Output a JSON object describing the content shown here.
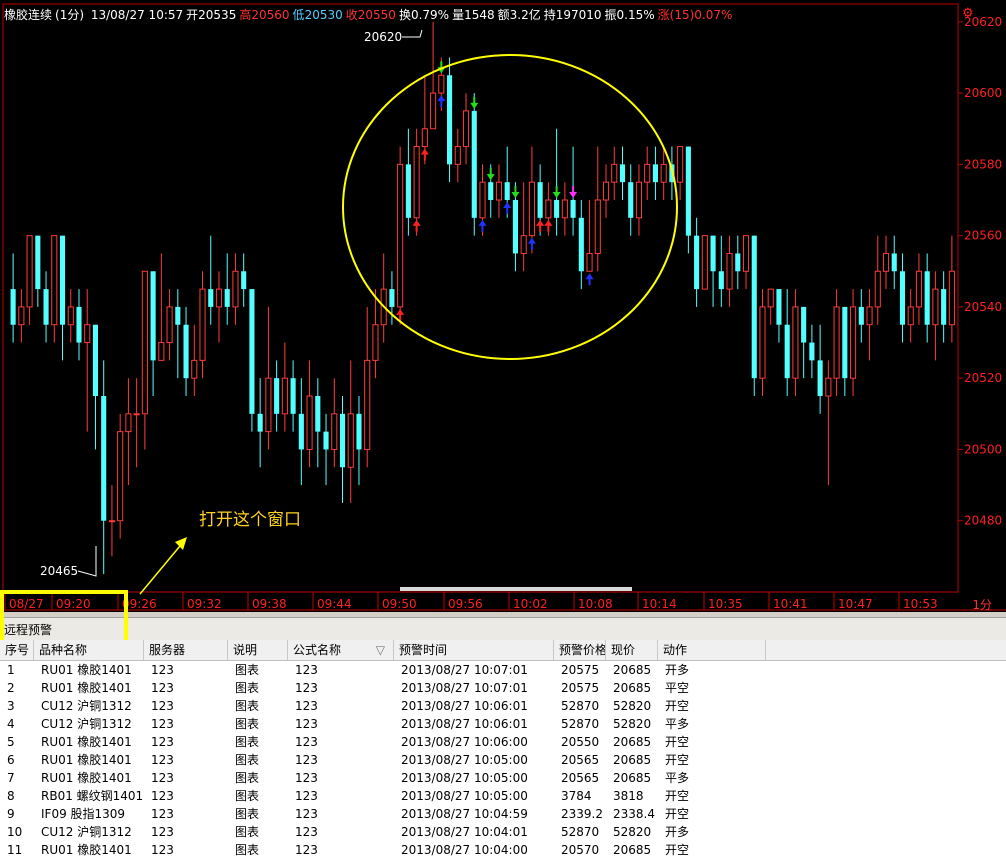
{
  "header": {
    "name": "橡胶连续",
    "period": "(1分)",
    "datetime": "13/08/27 10:57",
    "open_label": "开",
    "open_value": "20535",
    "high_label": "高",
    "high_value": "20560",
    "low_label": "低",
    "low_value": "20530",
    "close_label": "收",
    "close_value": "20550",
    "turnover": "换0.79%",
    "volume": "量1548",
    "amount": "额3.2亿",
    "position": "持197010",
    "amplitude": "振0.15%",
    "change": "涨(15)0.07%"
  },
  "colors": {
    "up": "#ff3b3b",
    "down": "#54ffff",
    "annotation": "#ffff00",
    "axis": "#c00000",
    "label": "#ff2020"
  },
  "chart_data": {
    "type": "candlestick",
    "y_ticks": [
      "20620",
      "20600",
      "20580",
      "20560",
      "20540",
      "20520",
      "20500",
      "20480"
    ],
    "x_ticks": [
      "08/27",
      "09:20",
      "09:26",
      "09:32",
      "09:38",
      "09:44",
      "09:50",
      "09:56",
      "10:02",
      "10:08",
      "10:14",
      "10:35",
      "10:41",
      "10:47",
      "10:53"
    ],
    "ylim": [
      20460,
      20625
    ],
    "high_marker": "20620",
    "low_marker": "20465",
    "unit": "1分",
    "candles": [
      [
        20545,
        20535,
        20555,
        20530
      ],
      [
        20535,
        20540,
        20545,
        20530
      ],
      [
        20540,
        20560,
        20560,
        20535
      ],
      [
        20560,
        20545,
        20560,
        20540
      ],
      [
        20545,
        20535,
        20550,
        20530
      ],
      [
        20535,
        20560,
        20560,
        20530
      ],
      [
        20560,
        20535,
        20560,
        20525
      ],
      [
        20535,
        20540,
        20545,
        20530
      ],
      [
        20540,
        20530,
        20545,
        20525
      ],
      [
        20530,
        20535,
        20545,
        20505
      ],
      [
        20535,
        20515,
        20535,
        20500
      ],
      [
        20515,
        20480,
        20525,
        20465
      ],
      [
        20480,
        20480,
        20490,
        20470
      ],
      [
        20480,
        20505,
        20510,
        20475
      ],
      [
        20505,
        20510,
        20520,
        20490
      ],
      [
        20510,
        20510,
        20520,
        20495
      ],
      [
        20510,
        20550,
        20550,
        20500
      ],
      [
        20550,
        20525,
        20550,
        20515
      ],
      [
        20525,
        20530,
        20555,
        20525
      ],
      [
        20530,
        20540,
        20545,
        20525
      ],
      [
        20540,
        20535,
        20545,
        20520
      ],
      [
        20535,
        20520,
        20540,
        20515
      ],
      [
        20520,
        20525,
        20535,
        20515
      ],
      [
        20525,
        20545,
        20550,
        20520
      ],
      [
        20545,
        20540,
        20560,
        20535
      ],
      [
        20540,
        20545,
        20550,
        20530
      ],
      [
        20545,
        20540,
        20555,
        20535
      ],
      [
        20540,
        20550,
        20555,
        20535
      ],
      [
        20550,
        20545,
        20555,
        20540
      ],
      [
        20545,
        20510,
        20545,
        20505
      ],
      [
        20510,
        20505,
        20520,
        20495
      ],
      [
        20505,
        20520,
        20540,
        20500
      ],
      [
        20520,
        20510,
        20525,
        20505
      ],
      [
        20510,
        20520,
        20530,
        20505
      ],
      [
        20520,
        20510,
        20525,
        20505
      ],
      [
        20510,
        20500,
        20520,
        20490
      ],
      [
        20500,
        20515,
        20525,
        20495
      ],
      [
        20515,
        20505,
        20520,
        20495
      ],
      [
        20505,
        20500,
        20510,
        20490
      ],
      [
        20500,
        20510,
        20520,
        20495
      ],
      [
        20510,
        20495,
        20515,
        20485
      ],
      [
        20495,
        20510,
        20525,
        20485
      ],
      [
        20510,
        20500,
        20515,
        20490
      ],
      [
        20500,
        20525,
        20540,
        20495
      ],
      [
        20525,
        20535,
        20545,
        20520
      ],
      [
        20535,
        20545,
        20555,
        20530
      ],
      [
        20545,
        20540,
        20550,
        20535
      ],
      [
        20540,
        20580,
        20585,
        20535
      ],
      [
        20580,
        20565,
        20590,
        20560
      ],
      [
        20565,
        20585,
        20590,
        20560
      ],
      [
        20585,
        20590,
        20605,
        20580
      ],
      [
        20590,
        20600,
        20620,
        20590
      ],
      [
        20600,
        20605,
        20610,
        20595
      ],
      [
        20605,
        20580,
        20610,
        20575
      ],
      [
        20580,
        20585,
        20590,
        20575
      ],
      [
        20585,
        20595,
        20600,
        20580
      ],
      [
        20595,
        20565,
        20600,
        20560
      ],
      [
        20565,
        20575,
        20580,
        20560
      ],
      [
        20575,
        20570,
        20580,
        20565
      ],
      [
        20570,
        20575,
        20580,
        20565
      ],
      [
        20575,
        20570,
        20585,
        20565
      ],
      [
        20570,
        20555,
        20575,
        20550
      ],
      [
        20555,
        20560,
        20575,
        20550
      ],
      [
        20560,
        20575,
        20585,
        20555
      ],
      [
        20575,
        20565,
        20580,
        20560
      ],
      [
        20565,
        20570,
        20575,
        20560
      ],
      [
        20570,
        20565,
        20590,
        20560
      ],
      [
        20565,
        20570,
        20575,
        20560
      ],
      [
        20570,
        20565,
        20585,
        20560
      ],
      [
        20565,
        20550,
        20570,
        20545
      ],
      [
        20550,
        20555,
        20570,
        20550
      ],
      [
        20555,
        20570,
        20585,
        20550
      ],
      [
        20570,
        20575,
        20580,
        20565
      ],
      [
        20575,
        20580,
        20585,
        20570
      ],
      [
        20580,
        20575,
        20585,
        20570
      ],
      [
        20575,
        20565,
        20580,
        20560
      ],
      [
        20565,
        20575,
        20580,
        20560
      ],
      [
        20575,
        20580,
        20585,
        20570
      ],
      [
        20580,
        20575,
        20585,
        20570
      ],
      [
        20575,
        20580,
        20585,
        20570
      ],
      [
        20580,
        20575,
        20585,
        20570
      ],
      [
        20575,
        20585,
        20585,
        20570
      ],
      [
        20585,
        20560,
        20585,
        20555
      ],
      [
        20560,
        20545,
        20565,
        20540
      ],
      [
        20545,
        20560,
        20560,
        20545
      ],
      [
        20560,
        20550,
        20560,
        20540
      ],
      [
        20550,
        20545,
        20560,
        20540
      ],
      [
        20545,
        20555,
        20560,
        20540
      ],
      [
        20555,
        20550,
        20560,
        20545
      ],
      [
        20550,
        20560,
        20560,
        20545
      ],
      [
        20560,
        20520,
        20560,
        20515
      ],
      [
        20520,
        20540,
        20545,
        20515
      ],
      [
        20540,
        20545,
        20545,
        20535
      ],
      [
        20545,
        20535,
        20545,
        20530
      ],
      [
        20535,
        20520,
        20545,
        20515
      ],
      [
        20520,
        20540,
        20545,
        20515
      ],
      [
        20540,
        20530,
        20540,
        20520
      ],
      [
        20530,
        20525,
        20535,
        20520
      ],
      [
        20525,
        20515,
        20535,
        20510
      ],
      [
        20515,
        20520,
        20525,
        20490
      ],
      [
        20520,
        20540,
        20545,
        20515
      ],
      [
        20540,
        20520,
        20540,
        20515
      ],
      [
        20520,
        20540,
        20545,
        20515
      ],
      [
        20540,
        20535,
        20545,
        20530
      ],
      [
        20535,
        20540,
        20545,
        20525
      ],
      [
        20540,
        20550,
        20560,
        20535
      ],
      [
        20550,
        20555,
        20560,
        20545
      ],
      [
        20555,
        20550,
        20560,
        20545
      ],
      [
        20550,
        20535,
        20555,
        20530
      ],
      [
        20535,
        20540,
        20545,
        20530
      ],
      [
        20540,
        20550,
        20555,
        20535
      ],
      [
        20550,
        20535,
        20555,
        20530
      ],
      [
        20535,
        20545,
        20550,
        20525
      ],
      [
        20545,
        20535,
        20550,
        20530
      ],
      [
        20535,
        20550,
        20560,
        20530
      ]
    ],
    "signals": [
      {
        "i": 47,
        "type": "up",
        "color": "#ff2020"
      },
      {
        "i": 49,
        "type": "up",
        "color": "#ff2020"
      },
      {
        "i": 50,
        "type": "up",
        "color": "#ff2020"
      },
      {
        "i": 52,
        "type": "up",
        "color": "#2030ff"
      },
      {
        "i": 52,
        "type": "down",
        "color": "#20e020"
      },
      {
        "i": 56,
        "type": "down",
        "color": "#20e020"
      },
      {
        "i": 57,
        "type": "up",
        "color": "#2030ff"
      },
      {
        "i": 58,
        "type": "down",
        "color": "#20e020"
      },
      {
        "i": 60,
        "type": "up",
        "color": "#2030ff"
      },
      {
        "i": 61,
        "type": "down",
        "color": "#20e020"
      },
      {
        "i": 63,
        "type": "up",
        "color": "#2030ff"
      },
      {
        "i": 64,
        "type": "up",
        "color": "#ff2020"
      },
      {
        "i": 65,
        "type": "up",
        "color": "#ff2020"
      },
      {
        "i": 66,
        "type": "down",
        "color": "#20e020"
      },
      {
        "i": 68,
        "type": "down",
        "color": "#ff30ff"
      },
      {
        "i": 70,
        "type": "up",
        "color": "#2030ff"
      }
    ]
  },
  "annotation_text": "打开这个窗口",
  "panel": {
    "title": "远程预警",
    "columns": [
      "序号",
      "品种名称",
      "服务器",
      "说明",
      "公式名称",
      "预警时间",
      "预警价格",
      "现价",
      "动作"
    ],
    "rows": [
      [
        "1",
        "RU01 橡胶1401",
        "123",
        "图表",
        "123",
        "2013/08/27 10:07:01",
        "20575",
        "20685",
        "开多"
      ],
      [
        "2",
        "RU01 橡胶1401",
        "123",
        "图表",
        "123",
        "2013/08/27 10:07:01",
        "20575",
        "20685",
        "平空"
      ],
      [
        "3",
        "CU12 沪铜1312",
        "123",
        "图表",
        "123",
        "2013/08/27 10:06:01",
        "52870",
        "52820",
        "开空"
      ],
      [
        "4",
        "CU12 沪铜1312",
        "123",
        "图表",
        "123",
        "2013/08/27 10:06:01",
        "52870",
        "52820",
        "平多"
      ],
      [
        "5",
        "RU01 橡胶1401",
        "123",
        "图表",
        "123",
        "2013/08/27 10:06:00",
        "20550",
        "20685",
        "开空"
      ],
      [
        "6",
        "RU01 橡胶1401",
        "123",
        "图表",
        "123",
        "2013/08/27 10:05:00",
        "20565",
        "20685",
        "开空"
      ],
      [
        "7",
        "RU01 橡胶1401",
        "123",
        "图表",
        "123",
        "2013/08/27 10:05:00",
        "20565",
        "20685",
        "平多"
      ],
      [
        "8",
        "RB01 螺纹钢1401",
        "123",
        "图表",
        "123",
        "2013/08/27 10:05:00",
        "3784",
        "3818",
        "开空"
      ],
      [
        "9",
        "IF09 股指1309",
        "123",
        "图表",
        "123",
        "2013/08/27 10:04:59",
        "2339.2",
        "2338.4",
        "开空"
      ],
      [
        "10",
        "CU12 沪铜1312",
        "123",
        "图表",
        "123",
        "2013/08/27 10:04:01",
        "52870",
        "52820",
        "开多"
      ],
      [
        "11",
        "RU01 橡胶1401",
        "123",
        "图表",
        "123",
        "2013/08/27 10:04:00",
        "20570",
        "20685",
        "开空"
      ]
    ]
  }
}
